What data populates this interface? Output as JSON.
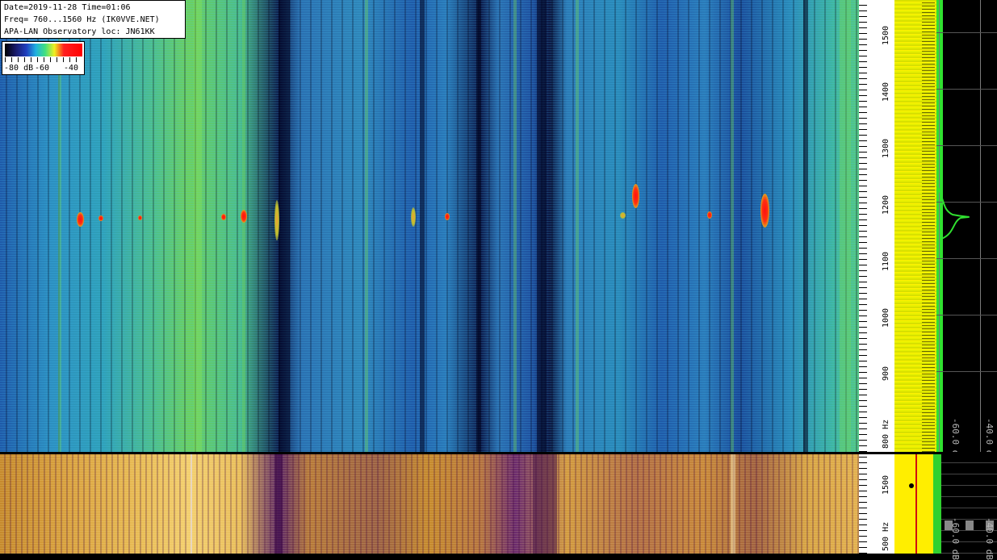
{
  "info": {
    "line1": "Date=2019-11-28 Time=01:06",
    "line2": "Freq= 760...1560 Hz (IK0VVE.NET)",
    "line3": "APA-LAN Observatory loc: JN61KK"
  },
  "scale": {
    "label_min": "-80 dB",
    "label_mid": "-60",
    "label_max": "-40"
  },
  "axis_top": {
    "ticks": [
      "1500",
      "1400",
      "1300",
      "1200",
      "1100",
      "1000",
      "900",
      "800 Hz"
    ]
  },
  "axis_bottom": {
    "ticks": [
      "1500",
      "500 Hz"
    ]
  },
  "spectrum": {
    "db_label_1": "-60.0 dB",
    "db_label_2": "-40.0 dB",
    "db_label_low_1": "-60.0 dB",
    "db_label_low_2": "-40.0 dB"
  },
  "colors": {
    "waterfall_low": "#0b1640",
    "waterfall_mid": "#2fa0b8",
    "waterfall_high": "#6cd060",
    "event": "#ff1010",
    "spectrum_fill": "#ffee00",
    "spectrum_peak": "#30e030"
  }
}
